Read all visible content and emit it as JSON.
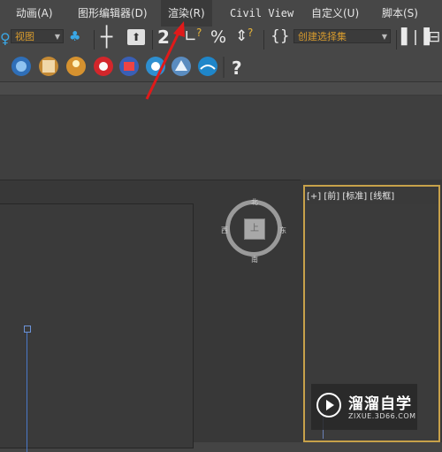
{
  "menubar": {
    "items": [
      {
        "label": "动画(A)"
      },
      {
        "label": "图形编辑器(D)"
      },
      {
        "label": "渲染(R)",
        "active": true
      },
      {
        "label": "Civil View"
      },
      {
        "label": "自定义(U)"
      },
      {
        "label": "脚本(S)"
      }
    ]
  },
  "toolbar": {
    "view_dropdown": "视图",
    "selection_set_dropdown": "创建选择集",
    "icons": [
      "snap-2d-icon",
      "angle-snap-icon",
      "percent-snap-icon",
      "spinner-snap-icon",
      "named-selection-icon",
      "mirror-icon",
      "align-icon"
    ]
  },
  "render_toolbar": {
    "icons": [
      "material-editor-icon",
      "render-setup-icon",
      "rendered-frame-icon",
      "render-icon",
      "render-production-icon",
      "environment-icon",
      "effects-icon",
      "help-icon"
    ]
  },
  "viewport_right": {
    "label": "[+] [前] [标准] [线框]"
  },
  "viewcube": {
    "north": "北",
    "south": "南",
    "east": "东",
    "west": "西",
    "face": "上"
  },
  "watermark": {
    "brand": "溜溜自学",
    "url": "ZIXUE.3D66.COM"
  },
  "colors": {
    "accent_orange": "#d79b2e",
    "active_viewport_border": "#c7a14a",
    "annotation_arrow": "#e01a1a"
  }
}
